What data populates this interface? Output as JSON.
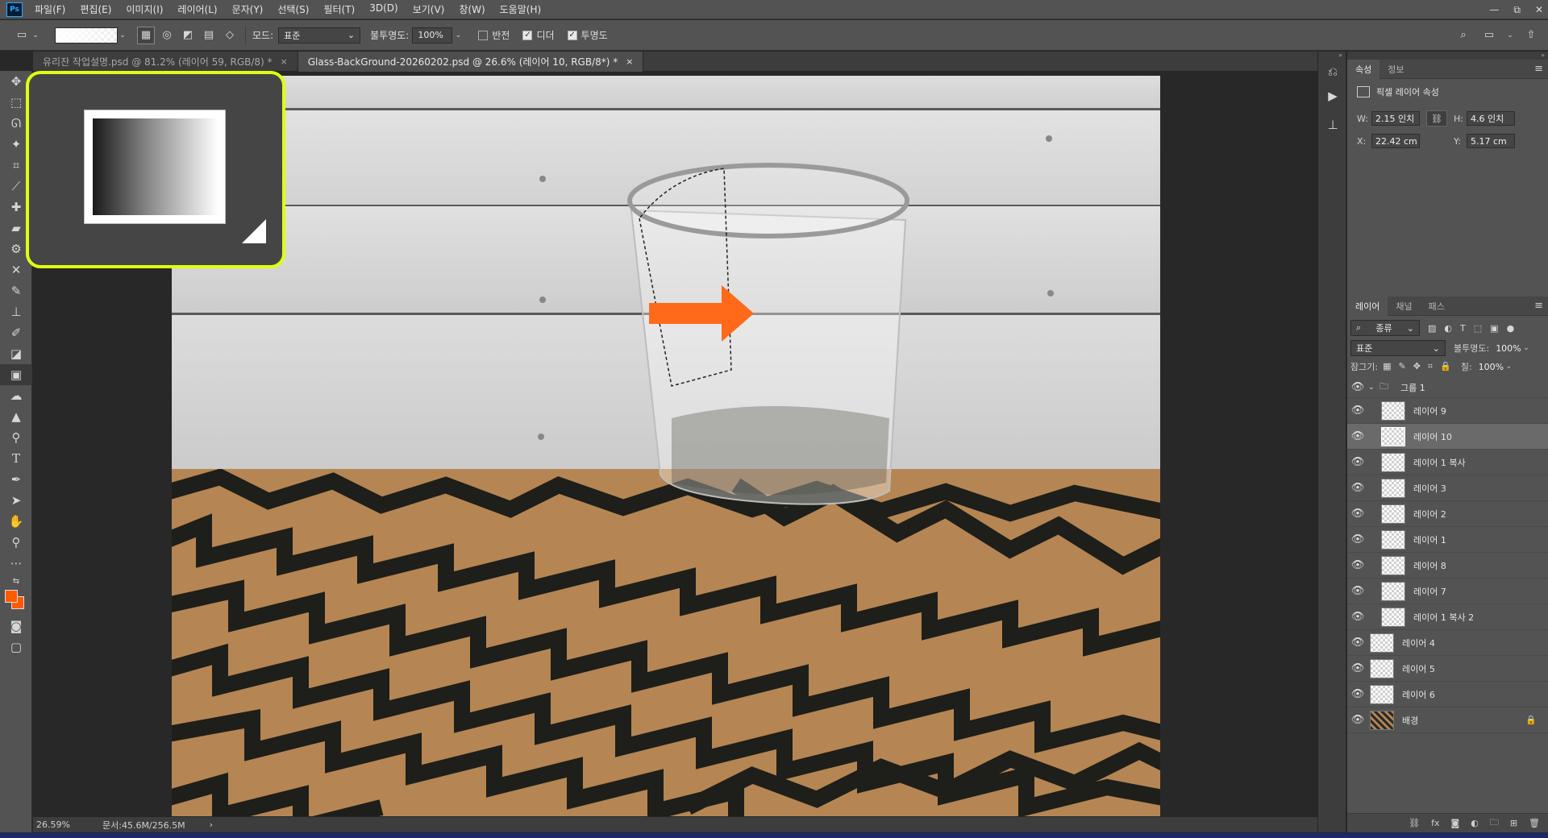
{
  "app": {
    "logo": "Ps"
  },
  "menubar": {
    "items": [
      "파일(F)",
      "편집(E)",
      "이미지(I)",
      "레이어(L)",
      "문자(Y)",
      "선택(S)",
      "필터(T)",
      "3D(D)",
      "보기(V)",
      "창(W)",
      "도움말(H)"
    ],
    "window_controls": [
      "—",
      "⧉",
      "✕"
    ]
  },
  "options": {
    "mode_label": "모드:",
    "mode_value": "표준",
    "opacity_label": "불투명도:",
    "opacity_value": "100%",
    "reverse_label": "반전",
    "dither_label": "디더",
    "transparency_label": "투명도",
    "reverse_checked": false,
    "dither_checked": true,
    "transparency_checked": true
  },
  "tabs": [
    {
      "label": "유리잔 작업설명.psd @ 81.2% (레이어 59, RGB/8) *",
      "close": "×"
    },
    {
      "label": "Glass-BackGround-20260202.psd @ 26.6% (레이어 10, RGB/8*) *",
      "close": "×"
    }
  ],
  "status": {
    "zoom": "26.59%",
    "doc": "문서:45.6M/256.5M",
    "arrow": "›"
  },
  "colors": {
    "foreground": "#ff5a00",
    "background": "#ff5a00",
    "highlight": "#dfff10",
    "arrow": "#ff6a1a"
  },
  "properties": {
    "tabs": [
      "속성",
      "정보"
    ],
    "title": "픽셀 레이어 속성",
    "w_label": "W:",
    "w_value": "2.15 인치",
    "h_label": "H:",
    "h_value": "4.6 인치",
    "x_label": "X:",
    "x_value": "22.42 cm",
    "y_label": "Y:",
    "y_value": "5.17 cm"
  },
  "layers_panel": {
    "tabs": [
      "레이어",
      "채널",
      "패스"
    ],
    "filter_label": "종류",
    "blend_mode": "표준",
    "opacity_label": "불투명도:",
    "opacity_value": "100%",
    "lock_label": "잠그기:",
    "fill_label": "칠:",
    "fill_value": "100%",
    "group_name": "그룹 1",
    "layers": [
      {
        "name": "레이어 9",
        "indent": true,
        "selected": false,
        "bg": false
      },
      {
        "name": "레이어 10",
        "indent": true,
        "selected": true,
        "bg": false
      },
      {
        "name": "레이어 1 복사",
        "indent": true,
        "selected": false,
        "bg": false
      },
      {
        "name": "레이어 3",
        "indent": true,
        "selected": false,
        "bg": false
      },
      {
        "name": "레이어 2",
        "indent": true,
        "selected": false,
        "bg": false
      },
      {
        "name": "레이어 1",
        "indent": true,
        "selected": false,
        "bg": false
      },
      {
        "name": "레이어 8",
        "indent": true,
        "selected": false,
        "bg": false
      },
      {
        "name": "레이어 7",
        "indent": true,
        "selected": false,
        "bg": false
      },
      {
        "name": "레이어 1 복사 2",
        "indent": true,
        "selected": false,
        "bg": false
      },
      {
        "name": "레이어 4",
        "indent": false,
        "selected": false,
        "bg": false
      },
      {
        "name": "레이어 5",
        "indent": false,
        "selected": false,
        "bg": false
      },
      {
        "name": "레이어 6",
        "indent": false,
        "selected": false,
        "bg": false
      },
      {
        "name": "배경",
        "indent": false,
        "selected": false,
        "bg": true
      }
    ],
    "footer_icons": [
      "link-icon",
      "fx-icon",
      "mask-icon",
      "adjustment-icon",
      "folder-icon",
      "new-layer-icon",
      "trash-icon"
    ]
  }
}
